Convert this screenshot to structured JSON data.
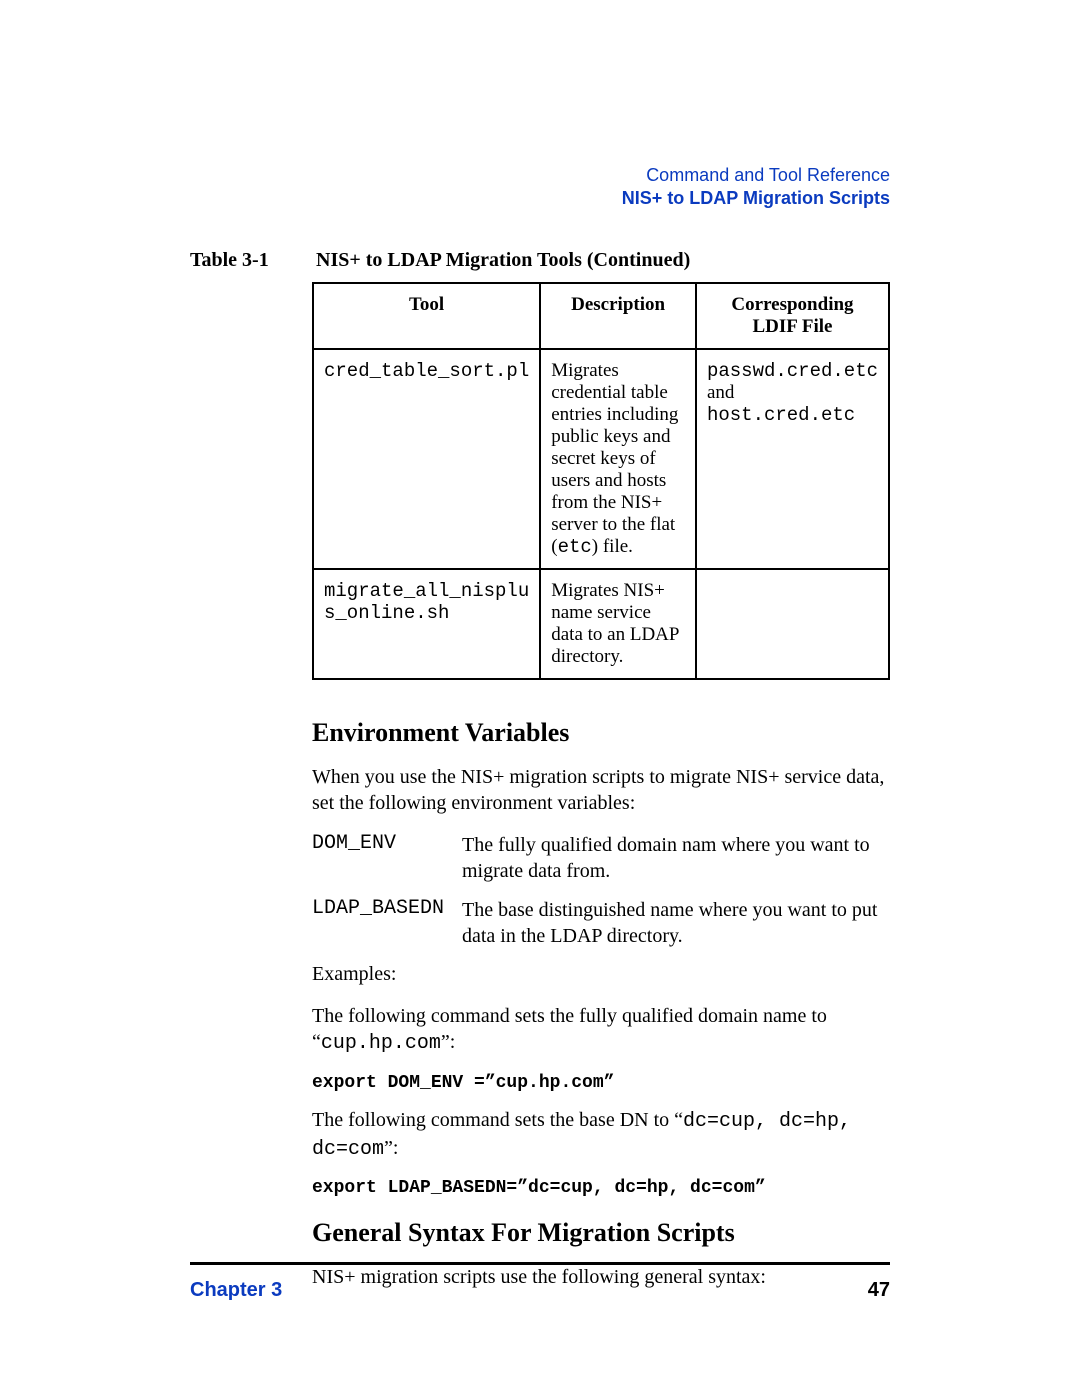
{
  "header": {
    "chapter": "Command and Tool Reference",
    "sub": "NIS+ to LDAP Migration Scripts"
  },
  "table": {
    "label": "Table 3-1",
    "caption": "NIS+ to LDAP Migration Tools (Continued)",
    "headers": {
      "c1": "Tool",
      "c2": "Description",
      "c3": "Corresponding LDIF File"
    },
    "rows": [
      {
        "tool": "cred_table_sort.pl",
        "desc_pre": "Migrates credential table entries including public keys and secret keys of users and hosts from the NIS+ server to the flat (",
        "desc_code": "etc",
        "desc_post": ") file.",
        "ldif_code1": "passwd.cred.etc",
        "ldif_mid": " and ",
        "ldif_code2": "host.cred.etc"
      },
      {
        "tool": "migrate_all_nisplus_online.sh",
        "desc_full": "Migrates NIS+ name service data to an LDAP directory.",
        "ldif": ""
      }
    ]
  },
  "section1": {
    "heading": "Environment Variables",
    "intro": "When you use the NIS+ migration scripts to migrate NIS+ service data, set the following environment variables:",
    "vars": [
      {
        "name": "DOM_ENV",
        "desc": "The fully qualified domain nam where you want to migrate data from."
      },
      {
        "name": "LDAP_BASEDN",
        "desc": "The base distinguished name where you want to put data in the LDAP directory."
      }
    ],
    "examples_label": "Examples:",
    "p1_pre": "The following command sets the fully qualified domain name to “",
    "p1_code": "cup.hp.com",
    "p1_post": "”:",
    "cmd1": "export DOM_ENV =”cup.hp.com”",
    "p2_pre": "The following command sets the base DN to “",
    "p2_code": "dc=cup, dc=hp, dc=com",
    "p2_post": "”:",
    "cmd2": "export LDAP_BASEDN=”dc=cup, dc=hp, dc=com”"
  },
  "section2": {
    "heading": "General Syntax For Migration Scripts",
    "body": "NIS+ migration scripts use the following general syntax:"
  },
  "footer": {
    "left": "Chapter 3",
    "right": "47"
  }
}
